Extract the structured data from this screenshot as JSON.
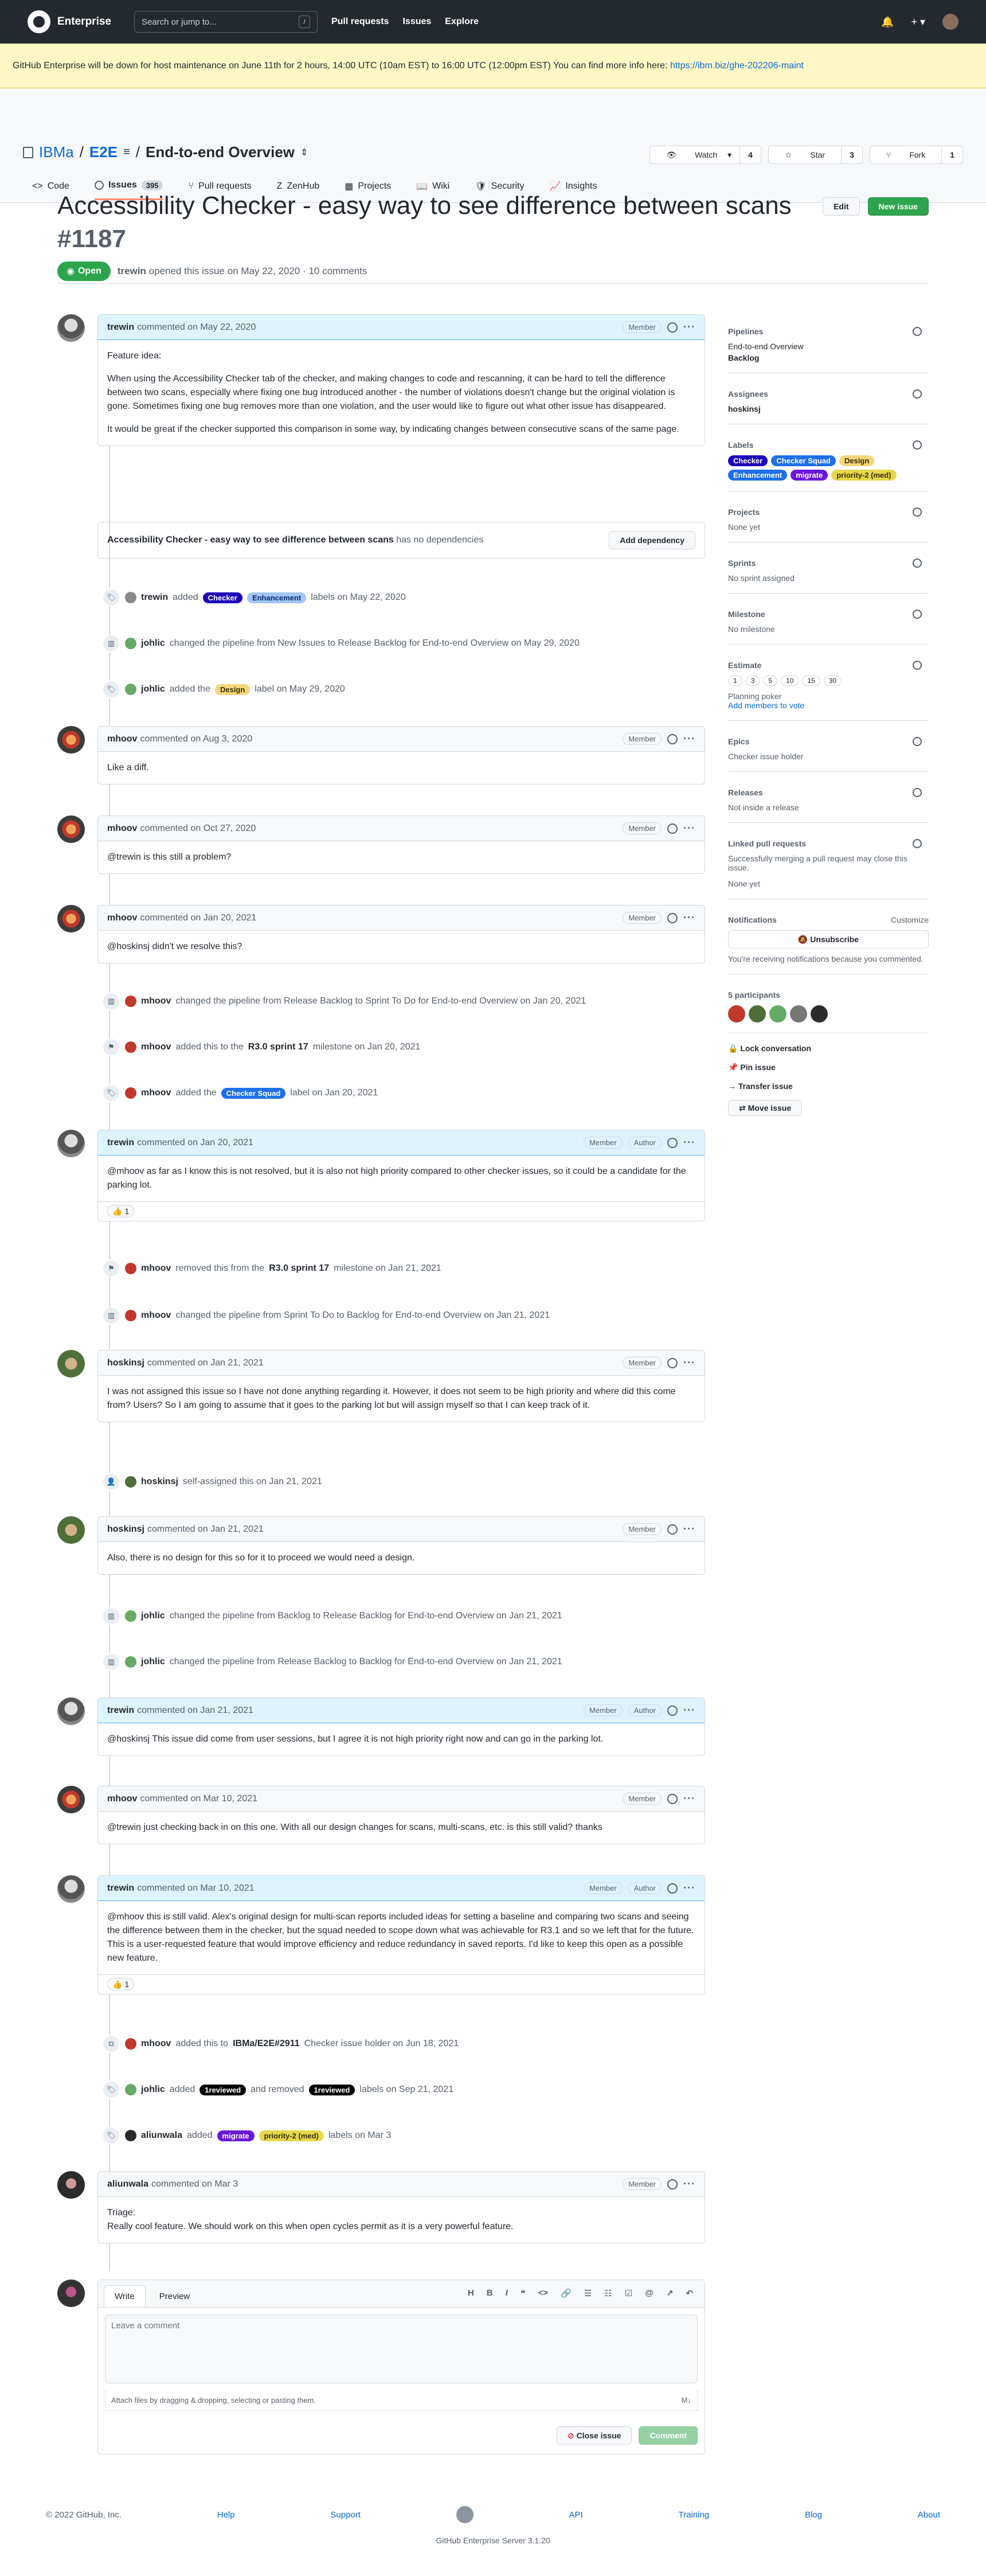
{
  "topnav": {
    "brand": "Enterprise",
    "search_placeholder": "Search or jump to...",
    "search_key": "/",
    "links": [
      "Pull requests",
      "Issues",
      "Explore"
    ],
    "plus": "+ ▾"
  },
  "banner": {
    "text": "GitHub Enterprise will be down for host maintenance on June 11th for 2 hours, 14:00 UTC (10am EST) to 16:00 UTC (12:00pm EST) You can find more info here:",
    "link": "https://ibm.biz/ghe-202206-maint"
  },
  "repo": {
    "owner": "IBMa",
    "name": "E2E",
    "sep": "/",
    "sep2": "/",
    "project": "End-to-end Overview",
    "watch": "Watch",
    "watch_count": "4",
    "star": "Star",
    "star_count": "3",
    "fork": "Fork",
    "fork_count": "1"
  },
  "tabs": [
    {
      "label": "Code"
    },
    {
      "label": "Issues",
      "count": "395"
    },
    {
      "label": "Pull requests"
    },
    {
      "label": "ZenHub"
    },
    {
      "label": "Projects"
    },
    {
      "label": "Wiki"
    },
    {
      "label": "Security"
    },
    {
      "label": "Insights"
    }
  ],
  "issue": {
    "title": "Accessibility Checker - easy way to see difference between scans",
    "number": "#1187",
    "state": "Open",
    "author": "trewin",
    "meta": "opened this issue on May 22, 2020 · 10 comments",
    "edit": "Edit",
    "new_issue": "New issue"
  },
  "first_comment": {
    "author": "trewin",
    "when": "commented on May 22, 2020",
    "role": "Member",
    "p1": "Feature idea:",
    "p2": "When using the Accessibility Checker tab of the checker, and making changes to code and rescanning, it can be hard to tell the difference between two scans, especially where fixing one bug introduced another - the number of violations doesn't change but the original violation is gone. Sometimes fixing one bug removes more than one violation, and the user would like to figure out what other issue has disappeared.",
    "p3": "It would be great if the checker supported this comparison in some way, by indicating changes between consecutive scans of the same page."
  },
  "dependency": {
    "title": "Accessibility Checker - easy way to see difference between scans",
    "status": "has no dependencies",
    "button": "Add dependency"
  },
  "events": {
    "e1": {
      "user": "trewin",
      "pre": "added",
      "l1": "Checker",
      "l2": "Enhancement",
      "post": "labels on May 22, 2020"
    },
    "e2": {
      "user": "johlic",
      "text": "changed the pipeline from New Issues to Release Backlog for End-to-end Overview on May 29, 2020"
    },
    "e3": {
      "user": "johlic",
      "pre": "added the",
      "l1": "Design",
      "post": "label on May 29, 2020"
    },
    "e4": {
      "user": "mhoov",
      "text": "changed the pipeline from Release Backlog to Sprint To Do for End-to-end Overview on Jan 20, 2021"
    },
    "e5": {
      "user": "mhoov",
      "pre": "added this to the",
      "ms": "R3.0 sprint 17",
      "post": "milestone on Jan 20, 2021"
    },
    "e6": {
      "user": "mhoov",
      "pre": "added the",
      "l1": "Checker Squad",
      "post": "label on Jan 20, 2021"
    },
    "e7": {
      "user": "mhoov",
      "pre": "removed this from the",
      "ms": "R3.0 sprint 17",
      "post": "milestone on Jan 21, 2021"
    },
    "e8": {
      "user": "mhoov",
      "text": "changed the pipeline from Sprint To Do to Backlog for End-to-end Overview on Jan 21, 2021"
    },
    "e9": {
      "user": "hoskinsj",
      "text": "self-assigned this on Jan 21, 2021"
    },
    "e10": {
      "user": "johlic",
      "text": "changed the pipeline from Backlog to Release Backlog for End-to-end Overview on Jan 21, 2021"
    },
    "e11": {
      "user": "johlic",
      "text": "changed the pipeline from Release Backlog to Backlog for End-to-end Overview on Jan 21, 2021"
    },
    "e12": {
      "user": "mhoov",
      "pre": "added this to",
      "ref": "IBMa/E2E#2911",
      "post": "Checker issue holder on Jun 18, 2021"
    },
    "e13": {
      "user": "johlic",
      "pre": "added",
      "l1": "1reviewed",
      "mid": "and removed",
      "l2": "1reviewed",
      "post": "labels on Sep 21, 2021"
    },
    "e14": {
      "user": "aliunwala",
      "pre": "added",
      "l1": "migrate",
      "l2": "priority-2 (med)",
      "post": "labels on Mar 3"
    }
  },
  "comments": {
    "c1": {
      "author": "mhoov",
      "when": "commented on Aug 3, 2020",
      "role": "Member",
      "body": "Like a diff."
    },
    "c2": {
      "author": "mhoov",
      "when": "commented on Oct 27, 2020",
      "role": "Member",
      "body": "@trewin is this still a problem?"
    },
    "c3": {
      "author": "mhoov",
      "when": "commented on Jan 20, 2021",
      "role": "Member",
      "body": "@hoskinsj didn't we resolve this?"
    },
    "c4": {
      "author": "trewin",
      "when": "commented on Jan 20, 2021",
      "role": "Member",
      "role2": "Author",
      "body": "@mhoov as far as I know this is not resolved, but it is also not high priority compared to other checker issues, so it could be a candidate for the parking lot.",
      "reaction": "👍 1"
    },
    "c5": {
      "author": "hoskinsj",
      "when": "commented on Jan 21, 2021",
      "role": "Member",
      "body": "I was not assigned this issue so I have not done anything regarding it. However, it does not seem to be high priority and where did this come from? Users? So I am going to assume that it goes to the parking lot but will assign myself so that I can keep track of it."
    },
    "c6": {
      "author": "hoskinsj",
      "when": "commented on Jan 21, 2021",
      "role": "Member",
      "body": "Also, there is no design for this so for it to proceed we would need a design."
    },
    "c7": {
      "author": "trewin",
      "when": "commented on Jan 21, 2021",
      "role": "Member",
      "role2": "Author",
      "body": "@hoskinsj This issue did come from user sessions, but I agree it is not high priority right now and can go in the parking lot."
    },
    "c8": {
      "author": "mhoov",
      "when": "commented on Mar 10, 2021",
      "role": "Member",
      "body": "@trewin just checking back in on this one. With all our design changes for scans, multi-scans, etc. is this still valid? thanks"
    },
    "c9": {
      "author": "trewin",
      "when": "commented on Mar 10, 2021",
      "role": "Member",
      "role2": "Author",
      "body": "@mhoov this is still valid. Alex's original design for multi-scan reports included ideas for setting a baseline and comparing two scans and seeing the difference between them in the checker, but the squad needed to scope down what was achievable for R3.1 and so we left that for the future. This is a user-requested feature that would improve efficiency and reduce redundancy in saved reports. I'd like to keep this open as a possible new feature.",
      "reaction": "👍 1"
    },
    "c10": {
      "author": "aliunwala",
      "when": "commented on Mar 3",
      "role": "Member",
      "body1": "Triage:",
      "body2": "Really cool feature. We should work on this when open cycles permit as it is a very powerful feature."
    }
  },
  "sidebar": {
    "pipelines": {
      "title": "Pipelines",
      "board": "End-to-end Overview",
      "col": "Backlog"
    },
    "assignees": {
      "title": "Assignees",
      "user": "hoskinsj"
    },
    "labels": {
      "title": "Labels",
      "items": [
        "Checker",
        "Checker Squad",
        "Design",
        "Enhancement",
        "migrate",
        "priority-2 (med)"
      ]
    },
    "projects": {
      "title": "Projects",
      "value": "None yet"
    },
    "sprints": {
      "title": "Sprints",
      "value": "No sprint assigned"
    },
    "milestone": {
      "title": "Milestone",
      "value": "No milestone"
    },
    "estimate": {
      "title": "Estimate",
      "points": [
        "1",
        "3",
        "5",
        "10",
        "15",
        "30"
      ],
      "poker": "Planning poker",
      "add": "Add members to vote"
    },
    "epics": {
      "title": "Epics",
      "value": "Checker issue holder"
    },
    "releases": {
      "title": "Releases",
      "value": "Not inside a release"
    },
    "linked": {
      "title": "Linked pull requests",
      "desc": "Successfully merging a pull request may close this issue.",
      "value": "None yet"
    },
    "notifications": {
      "title": "Notifications",
      "customize": "Customize",
      "button": "Unsubscribe",
      "desc": "You're receiving notifications because you commented."
    },
    "participants": {
      "title": "5 participants"
    },
    "actions": [
      "Lock conversation",
      "Pin issue",
      "Transfer issue",
      "Move issue"
    ]
  },
  "composer": {
    "write": "Write",
    "preview": "Preview",
    "placeholder": "Leave a comment",
    "attach": "Attach files by dragging & dropping, selecting or pasting them.",
    "close": "Close issue",
    "comment": "Comment",
    "tools": [
      "H",
      "B",
      "I",
      "❝",
      "<>",
      "🔗",
      "☰",
      "☷",
      "☑",
      "@",
      "↗",
      "↶"
    ]
  },
  "footer": {
    "copy": "© 2022 GitHub, Inc.",
    "links": [
      "Help",
      "Support",
      "API",
      "Training",
      "Blog",
      "About"
    ],
    "version": "GitHub Enterprise Server 3.1.20"
  }
}
